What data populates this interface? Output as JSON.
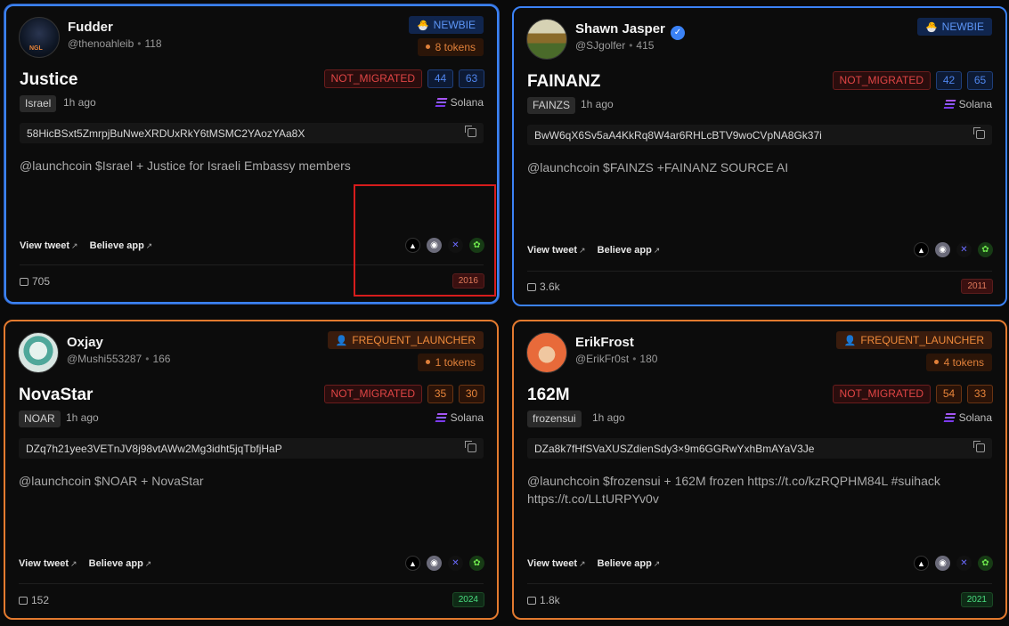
{
  "cards": [
    {
      "user": {
        "name": "Fudder",
        "handle": "@thenoahleib",
        "followers": "118",
        "verified": false
      },
      "badge": {
        "label": "NEWBIE",
        "icon": "chick-icon"
      },
      "tokens": "8 tokens",
      "coin": {
        "name": "Justice",
        "status": "NOT_MIGRATED",
        "num1": "44",
        "num2": "63",
        "ticker": "Israel",
        "ago": "1h ago",
        "chain": "Solana"
      },
      "address": "58HicBSxt5ZmrpjBuNweXRDUxRkY6tMSMC2YAozYAa8X",
      "description": "@launchcoin $Israel + Justice for Israeli Embassy members",
      "links": {
        "tweet": "View tweet",
        "app": "Believe app"
      },
      "comments": "705",
      "year": "2016"
    },
    {
      "user": {
        "name": "Shawn Jasper",
        "handle": "@SJgolfer",
        "followers": "415",
        "verified": true
      },
      "badge": {
        "label": "NEWBIE",
        "icon": "chick-icon"
      },
      "tokens": "",
      "coin": {
        "name": "FAINANZ",
        "status": "NOT_MIGRATED",
        "num1": "42",
        "num2": "65",
        "ticker": "FAINZS",
        "ago": "1h ago",
        "chain": "Solana"
      },
      "address": "BwW6qX6Sv5aA4KkRq8W4ar6RHLcBTV9woCVpNA8Gk37i",
      "description": "@launchcoin $FAINZS +FAINANZ SOURCE AI",
      "links": {
        "tweet": "View tweet",
        "app": "Believe app"
      },
      "comments": "3.6k",
      "year": "2011"
    },
    {
      "user": {
        "name": "Oxjay",
        "handle": "@Mushi553287",
        "followers": "166",
        "verified": false
      },
      "badge": {
        "label": "FREQUENT_LAUNCHER",
        "icon": "person-icon"
      },
      "tokens": "1 tokens",
      "coin": {
        "name": "NovaStar",
        "status": "NOT_MIGRATED",
        "num1": "35",
        "num2": "30",
        "ticker": "NOAR",
        "ago": "1h ago",
        "chain": "Solana"
      },
      "address": "DZq7h21yee3VETnJV8j98vtAWw2Mg3idht5jqTbfjHaP",
      "description": "@launchcoin $NOAR + NovaStar",
      "links": {
        "tweet": "View tweet",
        "app": "Believe app"
      },
      "comments": "152",
      "year": "2024"
    },
    {
      "user": {
        "name": "ErikFrost",
        "handle": "@ErikFr0st",
        "followers": "180",
        "verified": false
      },
      "badge": {
        "label": "FREQUENT_LAUNCHER",
        "icon": "person-icon"
      },
      "tokens": "4 tokens",
      "coin": {
        "name": "162M",
        "status": "NOT_MIGRATED",
        "num1": "54",
        "num2": "33",
        "ticker": "frozensui",
        "ago": "1h ago",
        "chain": "Solana"
      },
      "address": "DZa8k7fHfSVaXUSZdienSdy3×9m6GGRwYxhBmAYaV3Je",
      "description": "@launchcoin $frozensui + 162M frozen https://t.co/kzRQPHM84L #suihack https://t.co/LLtURPYv0v",
      "links": {
        "tweet": "View tweet",
        "app": "Believe app"
      },
      "comments": "1.8k",
      "year": "2021"
    }
  ],
  "colors": {
    "blue_border": "#3b82f6",
    "orange_border": "#e37a2f",
    "highlight": "#d71c1c"
  }
}
